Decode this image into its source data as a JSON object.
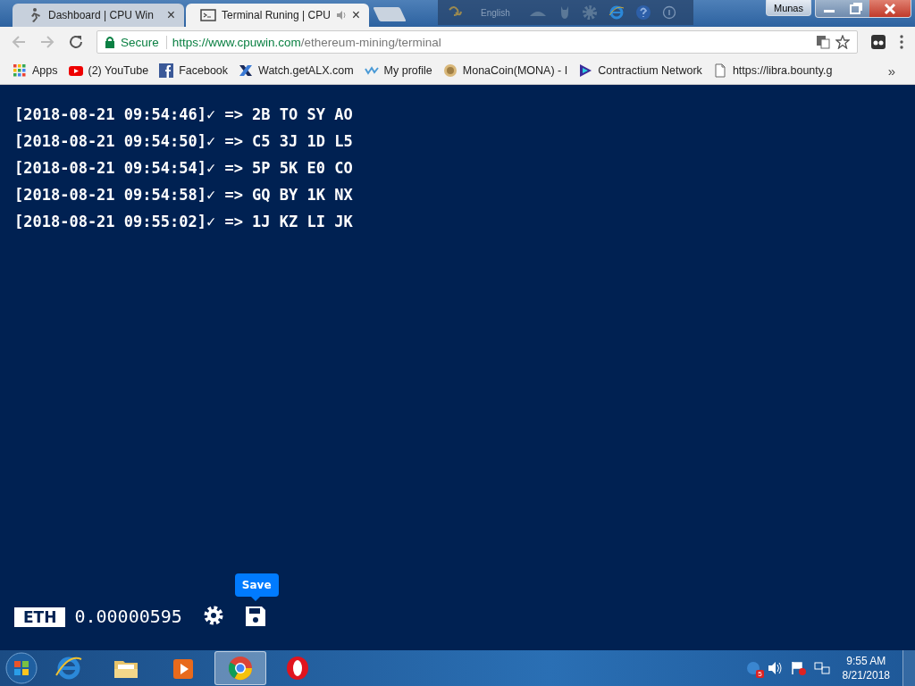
{
  "tabs": [
    {
      "label": "Dashboard | CPU Win",
      "selected": false,
      "close": "×"
    },
    {
      "label": "Terminal Runing | CPU",
      "selected": true,
      "close": "×"
    }
  ],
  "ime_bar": {
    "language": "English"
  },
  "window": {
    "user": "Munas"
  },
  "address_bar": {
    "secure_label": "Secure",
    "url_host": "https://www.cpuwin.com",
    "url_path": "/ethereum-mining/terminal"
  },
  "bookmarks": [
    {
      "label": "Apps"
    },
    {
      "label": "(2) YouTube"
    },
    {
      "label": "Facebook"
    },
    {
      "label": "Watch.getALX.com"
    },
    {
      "label": "My profile"
    },
    {
      "label": "MonaCoin(MONA) - I"
    },
    {
      "label": "Contractium Network"
    },
    {
      "label": "https://libra.bounty.g"
    }
  ],
  "bookmarks_more": "»",
  "terminal": {
    "lines": [
      "[2018-08-21 09:54:46]✓ => 2B TO SY AO",
      "[2018-08-21 09:54:50]✓ => C5 3J 1D L5",
      "[2018-08-21 09:54:54]✓ => 5P 5K E0 CO",
      "[2018-08-21 09:54:58]✓ => GQ BY 1K NX",
      "[2018-08-21 09:55:02]✓ => 1J KZ LI JK"
    ]
  },
  "footer": {
    "currency": "ETH",
    "balance": "0.00000595",
    "tooltip": "Save"
  },
  "taskbar": {
    "apps": [
      {
        "selected": false
      },
      {
        "selected": false
      },
      {
        "selected": false
      },
      {
        "selected": true
      },
      {
        "selected": false
      }
    ],
    "tray_badge": "5",
    "time": "9:55 AM",
    "date": "8/21/2018"
  }
}
